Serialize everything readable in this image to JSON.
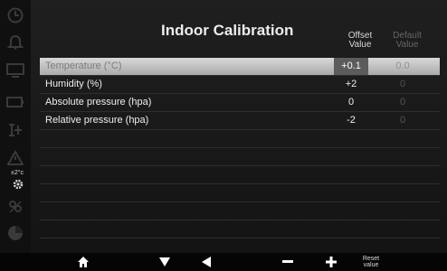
{
  "sidebar": {
    "items": [
      {
        "icon": "clock-icon"
      },
      {
        "icon": "bell-icon"
      },
      {
        "icon": "monitor-icon"
      },
      {
        "icon": "battery-icon"
      },
      {
        "icon": "network-icon"
      },
      {
        "icon": "warning-icon"
      },
      {
        "icon": "calibration-icon",
        "label": "±2°c",
        "active": true
      },
      {
        "icon": "stats-icon"
      },
      {
        "icon": "pie-icon"
      }
    ]
  },
  "header": {
    "title": "Indoor Calibration",
    "offset_col_line1": "Offset",
    "offset_col_line2": "Value",
    "default_col_line1": "Default",
    "default_col_line2": "Value"
  },
  "rows": [
    {
      "label": "Temperature (°C)",
      "offset": "+0.1",
      "default": "0.0",
      "selected": true
    },
    {
      "label": "Humidity (%)",
      "offset": "+2",
      "default": "0",
      "selected": false
    },
    {
      "label": "Absolute pressure (hpa)",
      "offset": "0",
      "default": "0",
      "selected": false
    },
    {
      "label": "Relative pressure (hpa)",
      "offset": "-2",
      "default": "0",
      "selected": false
    }
  ],
  "bottom_bar": {
    "reset_line1": "Reset",
    "reset_line2": "value"
  },
  "colors": {
    "selected_row": "#c2c2c2",
    "panel_bg": "#1a1a1a",
    "sidebar_icons": "#3a3a3a"
  }
}
